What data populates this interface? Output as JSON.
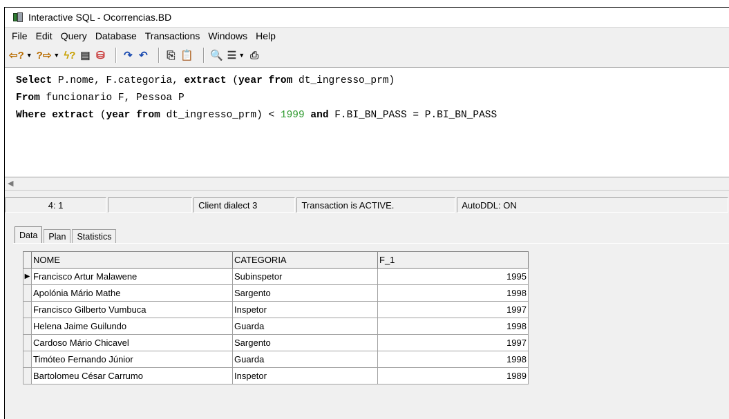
{
  "window": {
    "title": "Interactive SQL - Ocorrencias.BD"
  },
  "menu": [
    "File",
    "Edit",
    "Query",
    "Database",
    "Transactions",
    "Windows",
    "Help"
  ],
  "toolbar": {
    "icons": [
      "prev-query-icon",
      "next-query-icon",
      "execute-query-icon",
      "load-script-icon",
      "save-script-icon",
      "commit-icon",
      "rollback-icon",
      "copy-icon",
      "paste-icon",
      "find-icon",
      "metadata-icon",
      "print-icon"
    ]
  },
  "editor": {
    "line1": {
      "kw1": "Select",
      "rest1": " P.nome, F.categoria, ",
      "kw2": "extract",
      "rest2": " (",
      "kw3": "year",
      "sp": " ",
      "kw4": "from",
      "rest3": " dt_ingresso_prm)"
    },
    "line2": {
      "kw1": "From",
      "rest1": " funcionario F, Pessoa P"
    },
    "line3": {
      "kw1": "Where",
      "sp1": " ",
      "kw2": "extract",
      "rest1": " (",
      "kw3": "year",
      "sp2": " ",
      "kw4": "from",
      "rest2": " dt_ingresso_prm) < ",
      "num": "1999",
      "sp3": " ",
      "kw5": "and",
      "rest3": " F.BI_BN_PASS = P.BI_BN_PASS"
    }
  },
  "status": {
    "position": "4: 1",
    "dialect": "Client dialect 3",
    "transaction": "Transaction is ACTIVE.",
    "autoddl": "AutoDDL: ON"
  },
  "tabs": [
    "Data",
    "Plan",
    "Statistics"
  ],
  "grid": {
    "columns": [
      "NOME",
      "CATEGORIA",
      "F_1"
    ],
    "rows": [
      [
        "Francisco Artur Malawene",
        "Subinspetor",
        "1995"
      ],
      [
        "Apolónia Mário Mathe",
        "Sargento",
        "1998"
      ],
      [
        "Francisco Gilberto Vumbuca",
        "Inspetor",
        "1997"
      ],
      [
        "Helena Jaime Guilundo",
        "Guarda",
        "1998"
      ],
      [
        "Cardoso Mário Chicavel",
        "Sargento",
        "1997"
      ],
      [
        "Timóteo Fernando Júnior",
        "Guarda",
        "1998"
      ],
      [
        "Bartolomeu César Carrumo",
        "Inspetor",
        "1989"
      ]
    ]
  }
}
